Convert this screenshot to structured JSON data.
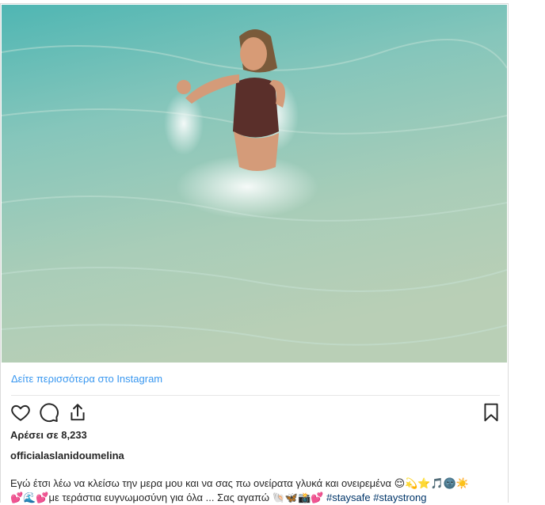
{
  "post": {
    "view_more_label": "Δείτε περισσότερα στο Instagram",
    "likes_text": "Αρέσει σε 8,233",
    "username": "officialaslanidoumelina",
    "caption_line1": "Εγώ έτσι λέω να κλείσω την μερα μου και να σας πω ονείρατα γλυκά και ονειρεμένα 😌💫⭐️🎵🌚☀️",
    "caption_line2_prefix": "💕🌊💕με τεράστια ευγνωμοσύνη για όλα ... Σας αγαπώ 🐚🦋📸💕",
    "hashtags": [
      "#staysafe",
      "#staystrong"
    ]
  },
  "icons": {
    "like": "heart-icon",
    "comment": "comment-icon",
    "share": "share-icon",
    "save": "bookmark-icon"
  },
  "colors": {
    "link": "#3897f0",
    "hashtag": "#003569",
    "text": "#262626",
    "border": "#dbdbdb"
  }
}
